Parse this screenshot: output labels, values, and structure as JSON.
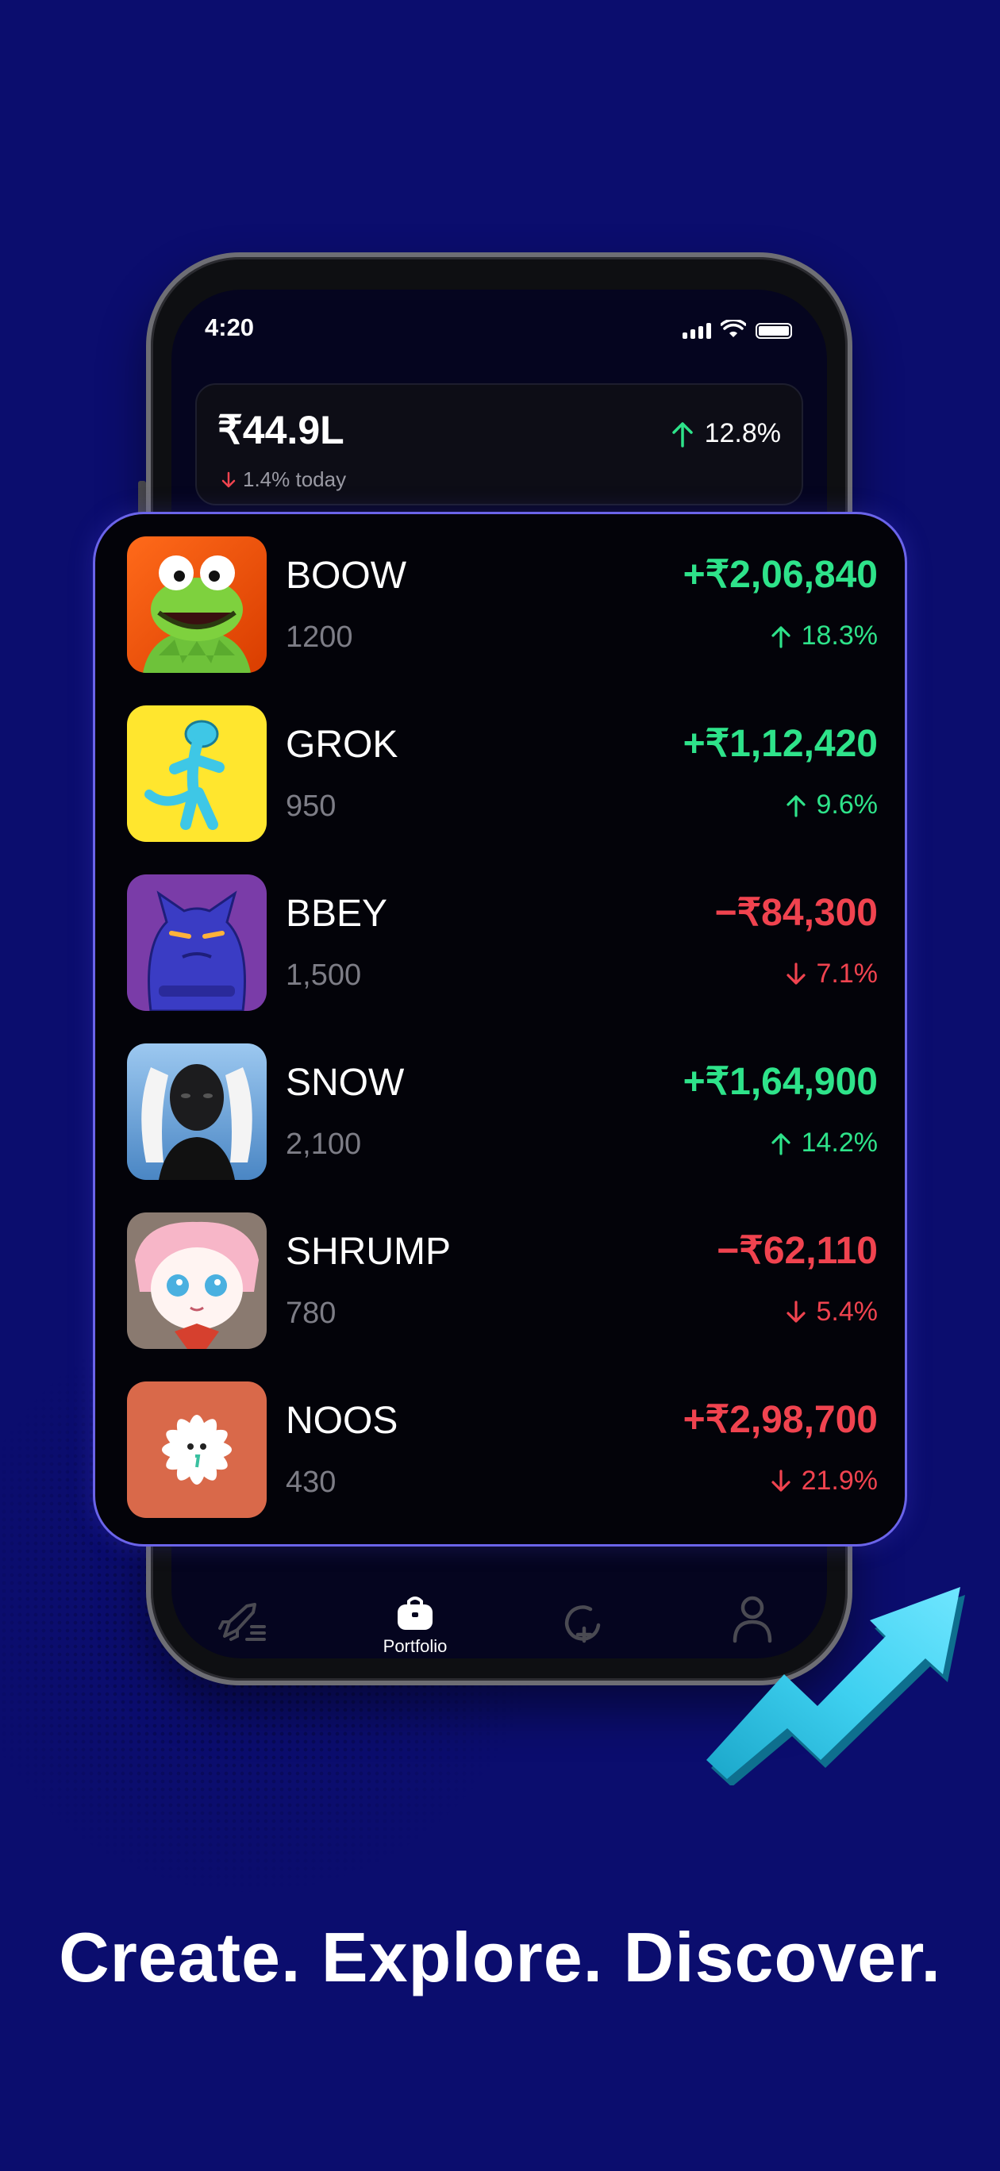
{
  "status_bar": {
    "time": "4:20"
  },
  "summary": {
    "total_value": "₹44.9L",
    "today_change": "1.4% today",
    "overall_change": "12.8%"
  },
  "holdings": [
    {
      "symbol": "BOOW",
      "quantity": "1200",
      "value": "+₹2,06,840",
      "change": "18.3%",
      "direction": "up",
      "value_color": "#2ee38a",
      "icon": "frog-avatar"
    },
    {
      "symbol": "GROK",
      "quantity": "950",
      "value": "+₹1,12,420",
      "change": "9.6%",
      "direction": "up",
      "value_color": "#2ee38a",
      "icon": "blue-lizard-avatar"
    },
    {
      "symbol": "BBEY",
      "quantity": "1,500",
      "value": "−₹84,300",
      "change": "7.1%",
      "direction": "down",
      "value_color": "#f0434f",
      "icon": "purple-cat-avatar"
    },
    {
      "symbol": "SNOW",
      "quantity": "2,100",
      "value": "+₹1,64,900",
      "change": "14.2%",
      "direction": "up",
      "value_color": "#2ee38a",
      "icon": "robot-woman-avatar"
    },
    {
      "symbol": "SHRUMP",
      "quantity": "780",
      "value": "−₹62,110",
      "change": "5.4%",
      "direction": "down",
      "value_color": "#f0434f",
      "icon": "anime-girl-avatar"
    },
    {
      "symbol": "NOOS",
      "quantity": "430",
      "value": "+₹2,98,700",
      "change": "21.9%",
      "direction": "down",
      "value_color": "#f0434f",
      "icon": "flower-avatar"
    }
  ],
  "tabbar": {
    "items": [
      {
        "icon": "rocket-icon",
        "label": ""
      },
      {
        "icon": "bag-icon",
        "label": "Portfolio"
      },
      {
        "icon": "add-circle-icon",
        "label": ""
      },
      {
        "icon": "user-icon",
        "label": ""
      }
    ]
  },
  "tagline": "Create. Explore. Discover.",
  "colors": {
    "background": "#0b0d6e",
    "gain": "#2ee38a",
    "loss": "#f0434f",
    "card_border": "#6b64ea"
  }
}
